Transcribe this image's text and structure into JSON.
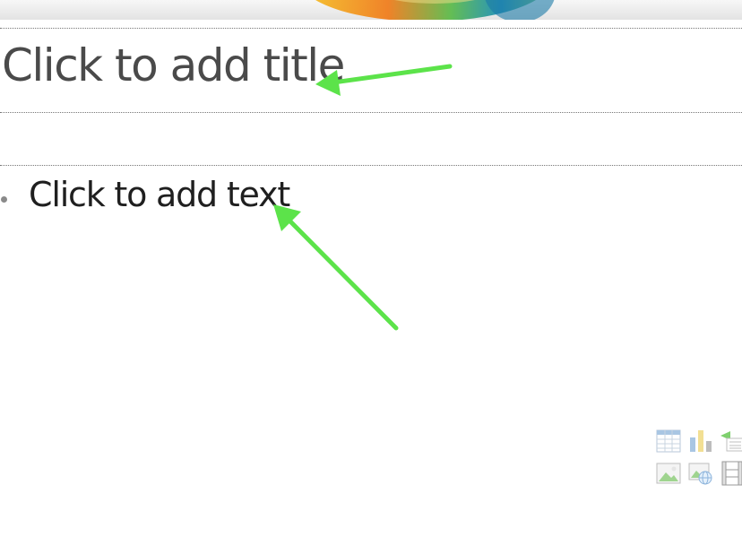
{
  "slide": {
    "title_placeholder": "Click to add title",
    "body_placeholder": "Click to add text"
  },
  "content_insert_icons": [
    {
      "name": "insert-table-icon"
    },
    {
      "name": "insert-chart-icon"
    },
    {
      "name": "insert-smartart-icon"
    },
    {
      "name": "insert-picture-icon"
    },
    {
      "name": "insert-online-picture-icon"
    },
    {
      "name": "insert-video-icon"
    }
  ],
  "colors": {
    "annotation_arrow": "#5ce34a",
    "title_text": "#4a4a4a",
    "body_text": "#1f1f1f"
  }
}
